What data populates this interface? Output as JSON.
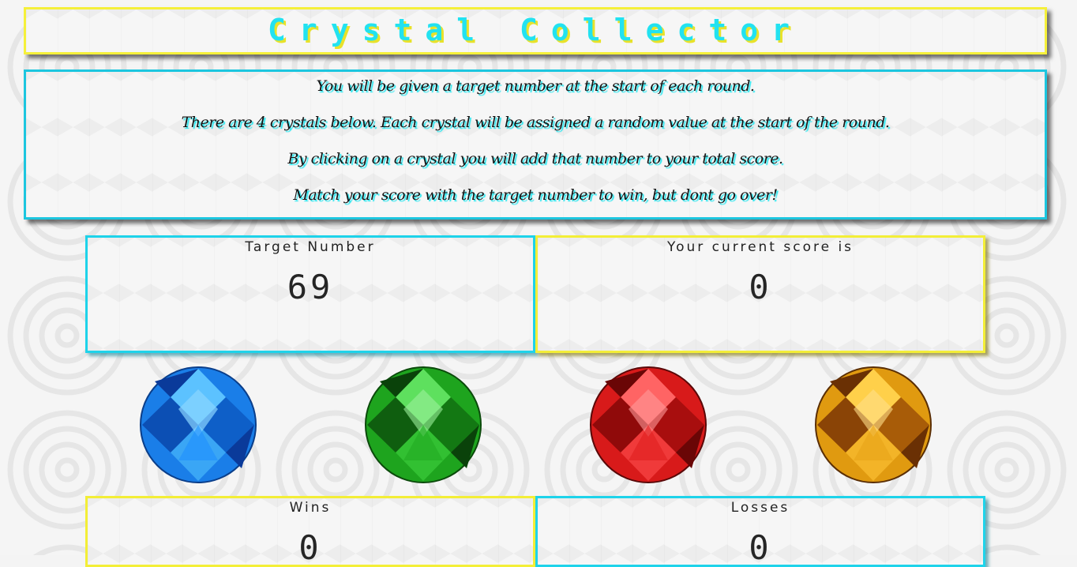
{
  "title": "Crystal Collector",
  "instructions": [
    "You will be given a target number at the start of each round.",
    "There are 4 crystals below. Each crystal will be assigned a random value at the start of the round.",
    "By clicking on a crystal you will add that number to your total score.",
    "Match your score with the target number to win, but dont go over!"
  ],
  "target": {
    "label": "Target Number",
    "value": "69"
  },
  "score": {
    "label": "Your current score is",
    "value": "0"
  },
  "wins": {
    "label": "Wins",
    "value": "0"
  },
  "losses": {
    "label": "Losses",
    "value": "0"
  },
  "crystals": [
    {
      "name": "blue-crystal",
      "color": "#1a7ee8"
    },
    {
      "name": "green-crystal",
      "color": "#1ea41e"
    },
    {
      "name": "red-crystal",
      "color": "#d81a1a"
    },
    {
      "name": "orange-crystal",
      "color": "#e09a10"
    }
  ],
  "colors": {
    "cyan": "#1ed3ea",
    "yellow": "#f3ee37"
  }
}
